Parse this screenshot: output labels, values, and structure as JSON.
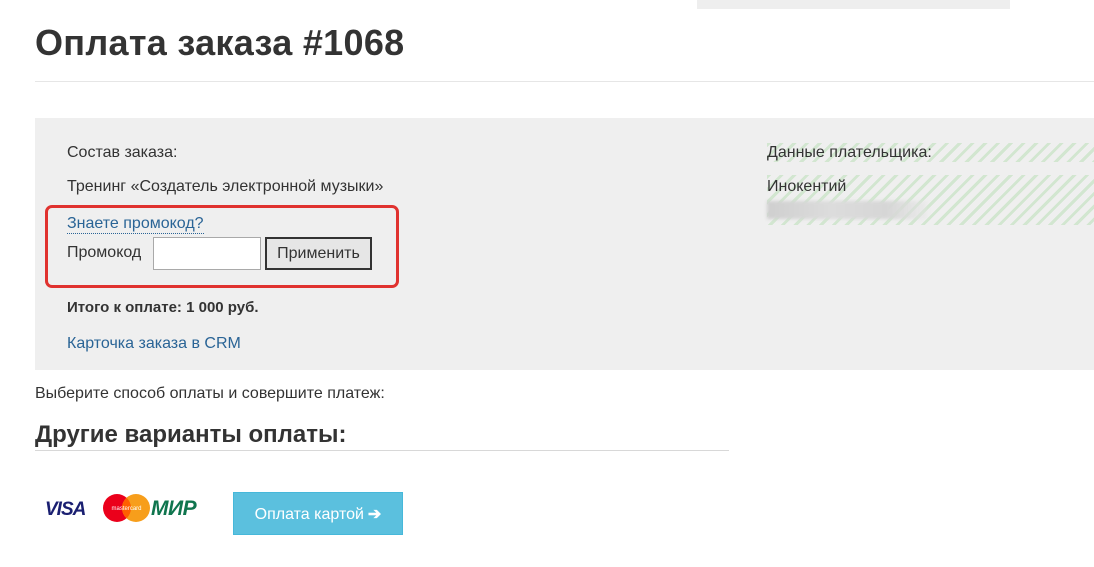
{
  "page": {
    "title": "Оплата заказа #1068"
  },
  "order": {
    "composition_label": "Состав заказа:",
    "item": "Тренинг «Создатель электронной музыки»",
    "promo_link": "Знаете промокод?",
    "promo_label": "Промокод",
    "promo_value": "",
    "apply_button": "Применить",
    "total": "Итого к оплате: 1 000 руб.",
    "crm_link": "Карточка заказа в CRM"
  },
  "payer": {
    "label": "Данные плательщика:",
    "name": "Инокентий"
  },
  "payment": {
    "instruction": "Выберите способ оплаты и совершите платеж:",
    "section_title": "Другие варианты оплаты:",
    "logos": {
      "visa": "VISA",
      "mastercard": "mastercard",
      "mir": "МИР"
    },
    "card_button": "Оплата картой",
    "card_button_icon": "arrow-right-icon"
  },
  "colors": {
    "highlight_border": "#e0322f",
    "link": "#2a6496",
    "primary_button": "#5bc0de"
  }
}
